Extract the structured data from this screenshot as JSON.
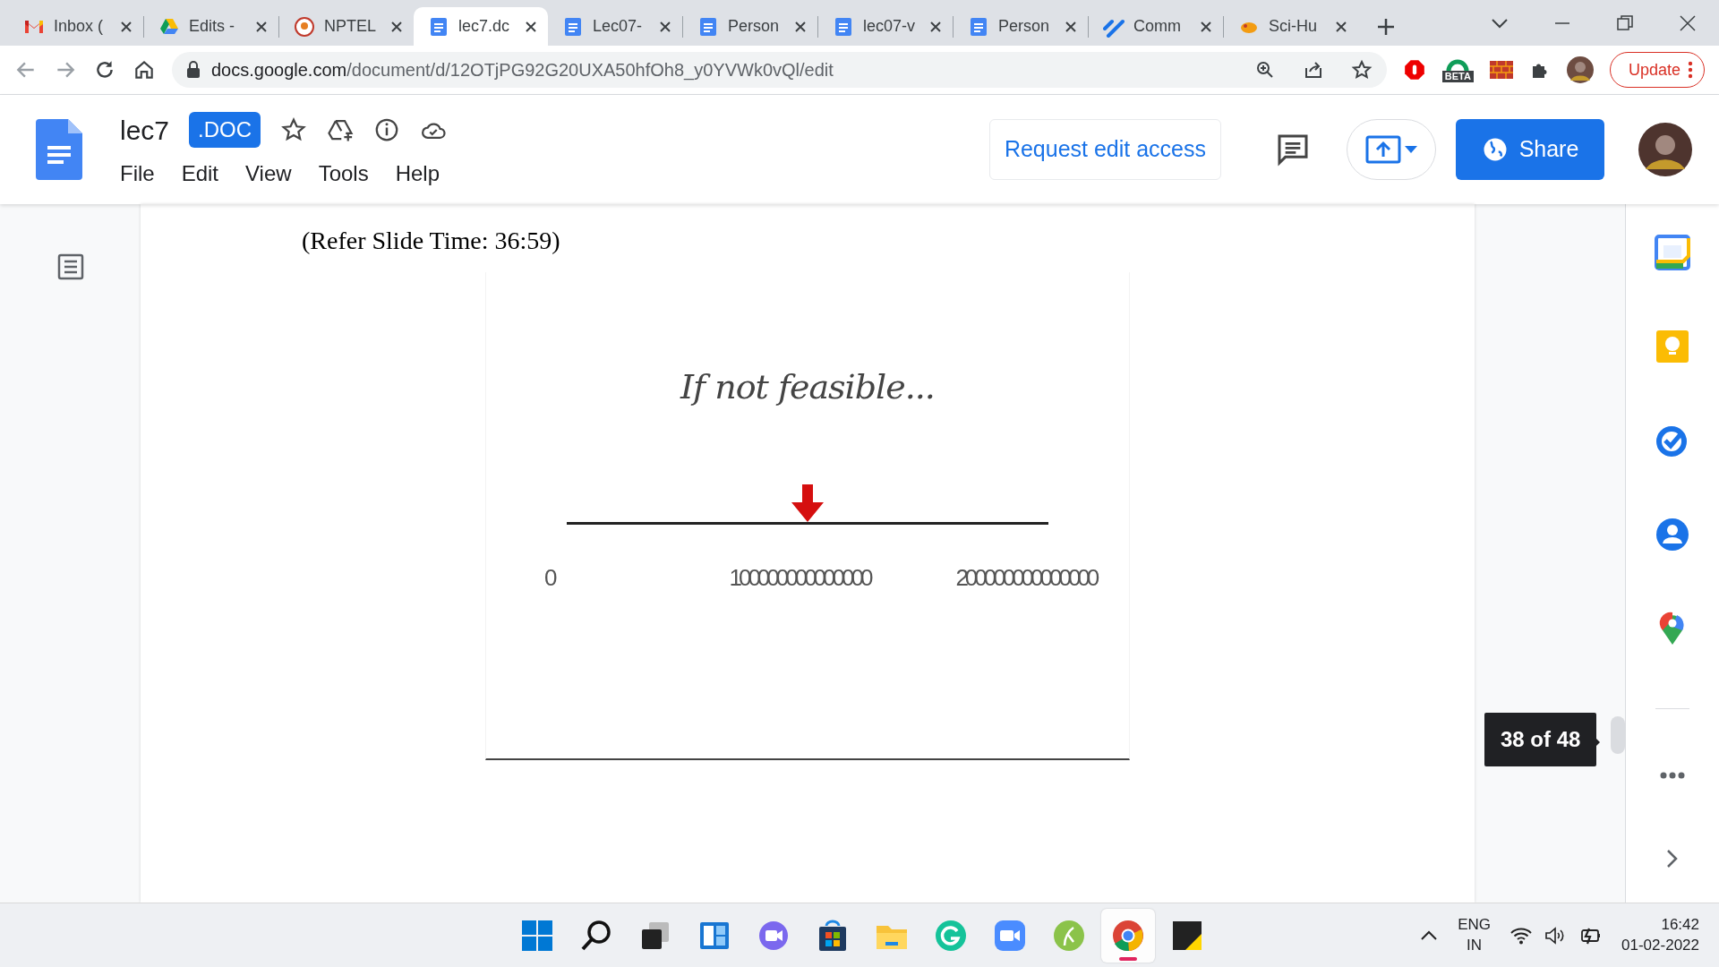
{
  "browser": {
    "tabs": [
      {
        "label": "Inbox (",
        "kind": "mail",
        "selected": false
      },
      {
        "label": "Edits -",
        "kind": "drive",
        "selected": false
      },
      {
        "label": "NPTEL",
        "kind": "emblem",
        "selected": false
      },
      {
        "label": "lec7.dc",
        "kind": "document",
        "selected": true
      },
      {
        "label": "Lec07-",
        "kind": "document",
        "selected": false
      },
      {
        "label": "Person",
        "kind": "document",
        "selected": false
      },
      {
        "label": "lec07-v",
        "kind": "document",
        "selected": false
      },
      {
        "label": "Person",
        "kind": "document",
        "selected": false
      },
      {
        "label": "Comm",
        "kind": "link",
        "selected": false
      },
      {
        "label": "Sci-Hu",
        "kind": "bird",
        "selected": false
      }
    ],
    "url": {
      "host": "docs.google.com",
      "path": "/document/d/12OTjPG92G20UXA50hfOh8_y0YVWk0vQl/edit"
    },
    "extension_badge": "BETA",
    "update_button": "Update"
  },
  "docs": {
    "title": "lec7",
    "badge": ".DOC",
    "menu": [
      "File",
      "Edit",
      "View",
      "Tools",
      "Help"
    ],
    "request_button": "Request edit access",
    "share_button": "Share"
  },
  "document": {
    "caption": "(Refer Slide Time: 36:59)",
    "slide": {
      "heading": "If not feasible...",
      "axis_labels": [
        "0",
        "100000000000000",
        "200000000000000"
      ]
    },
    "page_indicator": "38 of 48"
  },
  "taskbar": {
    "apps": [
      {
        "kind": "start",
        "selected": false
      },
      {
        "kind": "search",
        "selected": false
      },
      {
        "kind": "taskview",
        "selected": false
      },
      {
        "kind": "widgets",
        "selected": false
      },
      {
        "kind": "chat",
        "selected": false
      },
      {
        "kind": "store",
        "selected": false
      },
      {
        "kind": "explorer",
        "selected": false
      },
      {
        "kind": "grammarly",
        "selected": false
      },
      {
        "kind": "zoom",
        "selected": false
      },
      {
        "kind": "leaf",
        "selected": false
      },
      {
        "kind": "chrome",
        "selected": true
      },
      {
        "kind": "sticky",
        "selected": false
      }
    ],
    "language": [
      "ENG",
      "IN"
    ],
    "time": "16:42",
    "date": "01-02-2022"
  }
}
